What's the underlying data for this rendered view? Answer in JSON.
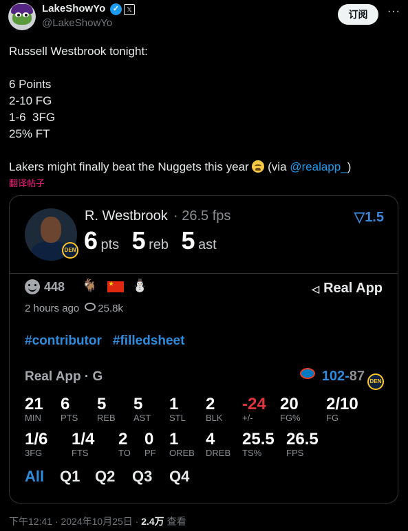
{
  "author": {
    "display_name": "LakeShowYo",
    "verified_mark": "✓",
    "badge": "𝕏",
    "handle": "@LakeShowYo"
  },
  "subscribe_label": "订阅",
  "more_label": "···",
  "tweet": {
    "line1": "Russell Westbrook tonight:",
    "line2": "6 Points",
    "line3": "2-10 FG",
    "line4": "1-6  3FG",
    "line5": "25% FT",
    "line6_pre": "Lakers might finally beat the Nuggets this year ",
    "line6_mid": " (via ",
    "mention": "@realapp_",
    "line6_post": ")"
  },
  "translate_label": "翻译帖子",
  "card": {
    "player_name": "R. Westbrook",
    "fps_text": "· 26.5 fps",
    "pts": "6",
    "pts_unit": "pts",
    "reb": "5",
    "reb_unit": "reb",
    "ast": "5",
    "ast_unit": "ast",
    "team_abbr": "DEN",
    "delta": "1.5",
    "reaction_count": "448",
    "goat": "🐐",
    "figure": "⛄",
    "brand": "Real App",
    "posted_ago": "2 hours ago",
    "view_count": "25.8k",
    "hashtags": [
      "#contributor",
      "#filledsheet"
    ],
    "game_label": "Real App · G",
    "score_home": "102",
    "score_sep": "-",
    "score_away": "87",
    "stats_row1": [
      {
        "v": "21",
        "l": "MIN"
      },
      {
        "v": "6",
        "l": "PTS"
      },
      {
        "v": "5",
        "l": "REB"
      },
      {
        "v": "5",
        "l": "AST"
      },
      {
        "v": "1",
        "l": "STL"
      },
      {
        "v": "2",
        "l": "BLK"
      },
      {
        "v": "-24",
        "l": "+/-"
      },
      {
        "v": "20",
        "l": "FG%"
      },
      {
        "v": "2/10",
        "l": "FG"
      }
    ],
    "stats_row2": [
      {
        "v": "1/6",
        "l": "3FG"
      },
      {
        "v": "1/4",
        "l": "FTS"
      },
      {
        "v": "2",
        "l": "TO"
      },
      {
        "v": "0",
        "l": "PF"
      },
      {
        "v": "1",
        "l": "OREB"
      },
      {
        "v": "4",
        "l": "DREB"
      },
      {
        "v": "25.5",
        "l": "TS%"
      },
      {
        "v": "26.5",
        "l": "FPS"
      }
    ],
    "tabs": [
      "All",
      "Q1",
      "Q2",
      "Q3",
      "Q4"
    ],
    "active_tab": "All"
  },
  "footer": {
    "time": "下午12:41 · 2024年10月25日 · ",
    "views": "2.4万",
    "views_label": " 查看"
  },
  "colors": {
    "accent": "#1d9bf0",
    "card_blue": "#2d8cdd",
    "negative": "#e0333c",
    "translate": "#f91880"
  }
}
